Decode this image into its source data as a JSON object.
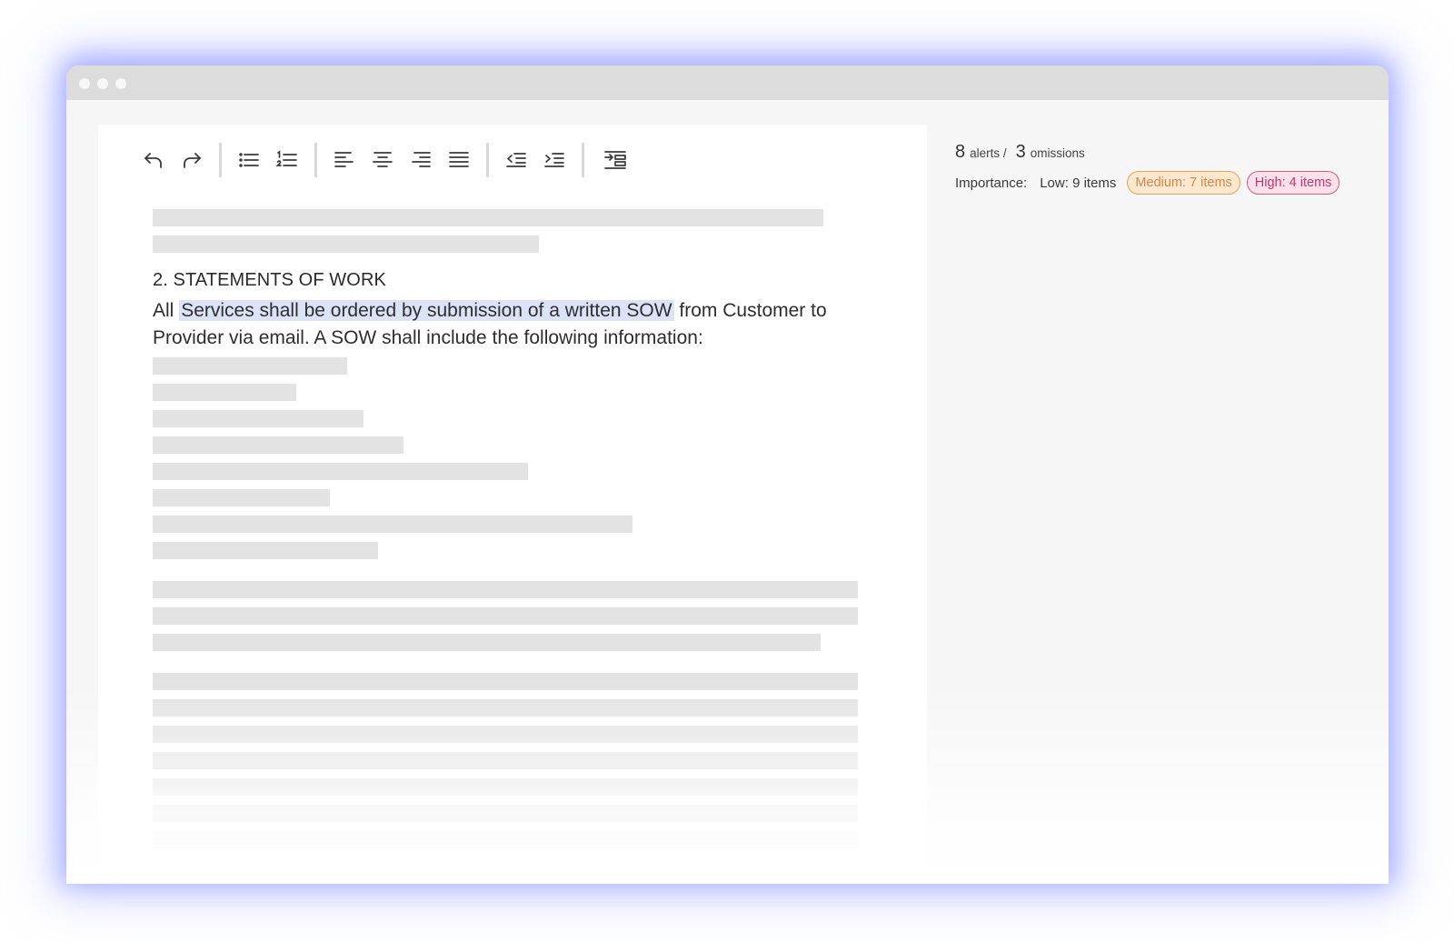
{
  "toolbar": {
    "buttons": [
      {
        "name": "undo-icon"
      },
      {
        "name": "redo-icon"
      },
      {
        "name": "bullet-list-icon"
      },
      {
        "name": "numbered-list-icon"
      },
      {
        "name": "align-left-icon"
      },
      {
        "name": "align-center-icon"
      },
      {
        "name": "align-right-icon"
      },
      {
        "name": "align-justify-icon"
      },
      {
        "name": "outdent-icon"
      },
      {
        "name": "indent-icon"
      },
      {
        "name": "insert-clause-icon"
      }
    ]
  },
  "document": {
    "section_heading": "2. STATEMENTS OF WORK",
    "para_start": "All ",
    "para_highlight": "Services shall be ordered by submission of a written SOW",
    "para_end": " from Customer to Provider via email. A SOW shall include the following information:"
  },
  "summary": {
    "alerts_count": "8",
    "alerts_label": "alerts /",
    "omissions_count": "3",
    "omissions_label": "omissions",
    "importance_label": "Importance:",
    "low": "Low: 9 items",
    "medium": "Medium: 7 items",
    "high": "High: 4 items"
  },
  "colors": {
    "highlight": "#dde3f6",
    "medium_accent": "#e5a35d",
    "high_accent": "#d45c87",
    "window_glow": "#8a93ff"
  }
}
